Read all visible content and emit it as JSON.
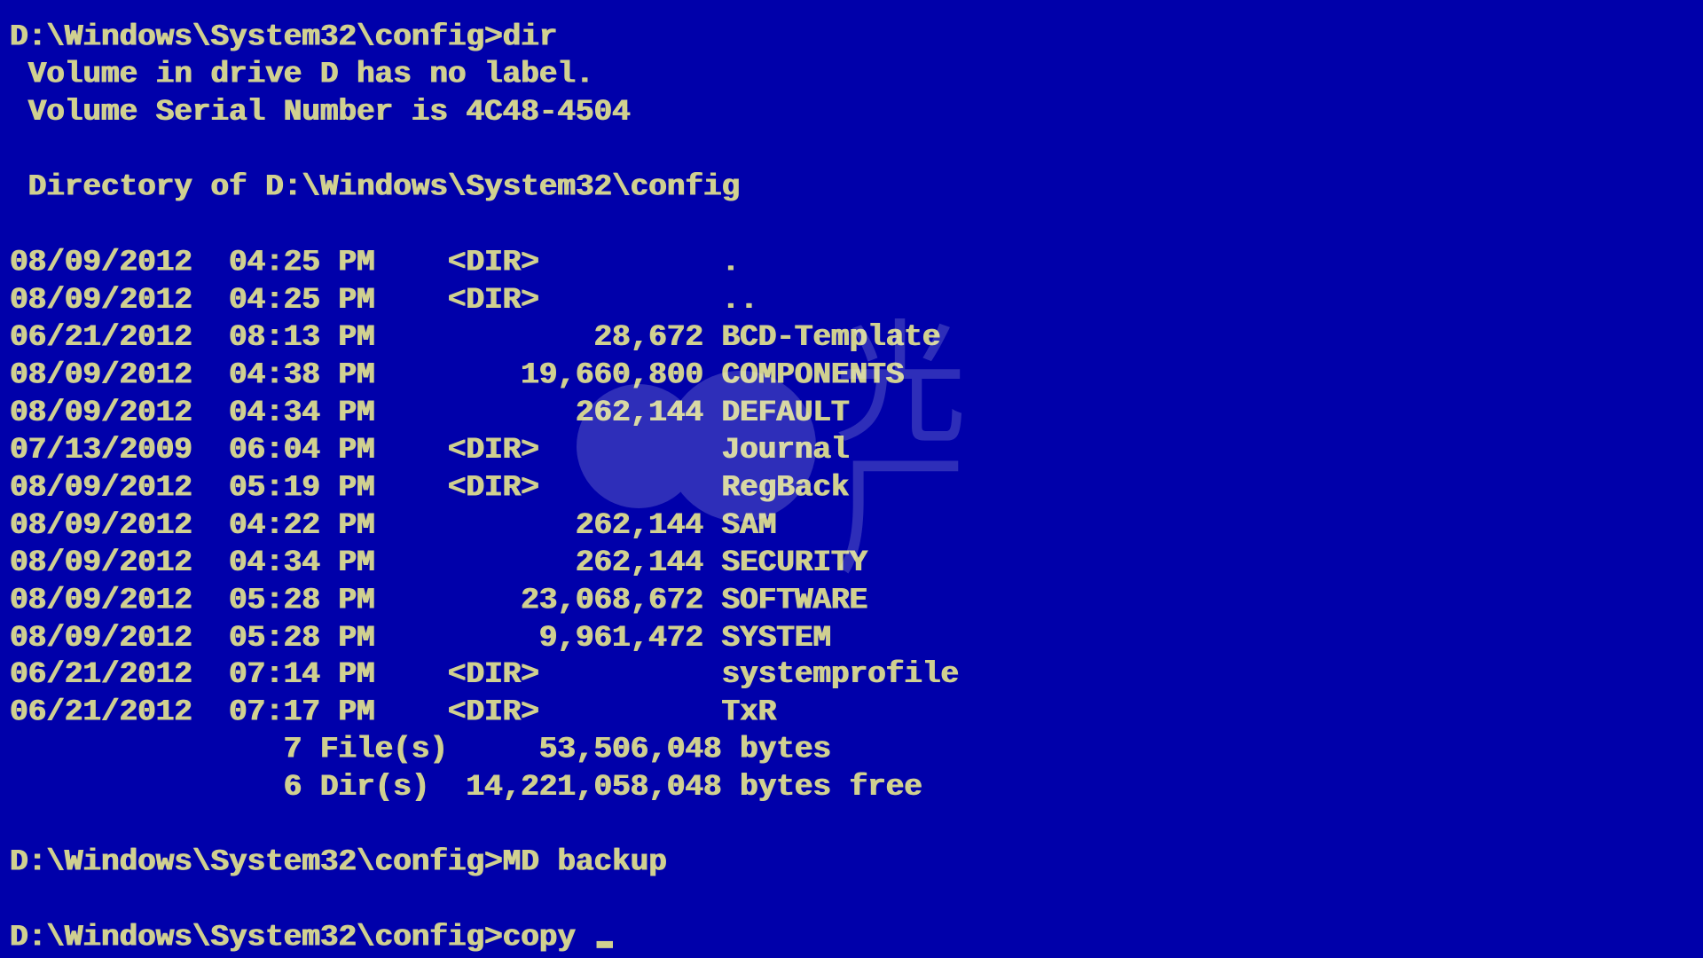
{
  "terminal": {
    "prompt1": "D:\\Windows\\System32\\config>",
    "cmd1": "dir",
    "volume_line": " Volume in drive D has no label.",
    "serial_line": " Volume Serial Number is 4C48-4504",
    "blank": "",
    "dir_of_line": " Directory of D:\\Windows\\System32\\config",
    "entries": [
      "08/09/2012  04:25 PM    <DIR>          .",
      "08/09/2012  04:25 PM    <DIR>          ..",
      "06/21/2012  08:13 PM            28,672 BCD-Template",
      "08/09/2012  04:38 PM        19,660,800 COMPONENTS",
      "08/09/2012  04:34 PM           262,144 DEFAULT",
      "07/13/2009  06:04 PM    <DIR>          Journal",
      "08/09/2012  05:19 PM    <DIR>          RegBack",
      "08/09/2012  04:22 PM           262,144 SAM",
      "08/09/2012  04:34 PM           262,144 SECURITY",
      "08/09/2012  05:28 PM        23,068,672 SOFTWARE",
      "08/09/2012  05:28 PM         9,961,472 SYSTEM",
      "06/21/2012  07:14 PM    <DIR>          systemprofile",
      "06/21/2012  07:17 PM    <DIR>          TxR"
    ],
    "summary_files": "               7 File(s)     53,506,048 bytes",
    "summary_dirs": "               6 Dir(s)  14,221,058,048 bytes free",
    "prompt2": "D:\\Windows\\System32\\config>",
    "cmd2": "MD backup",
    "prompt3": "D:\\Windows\\System32\\config>",
    "cmd3": "copy "
  },
  "watermark_text": "光厂"
}
